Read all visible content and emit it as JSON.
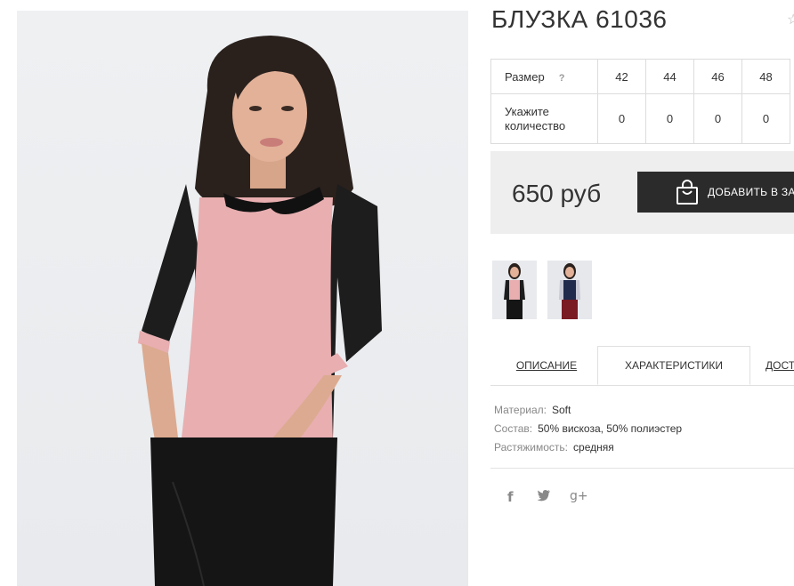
{
  "product": {
    "title": "БЛУЗКА 61036",
    "favorite_icon": "star-icon"
  },
  "size_table": {
    "size_label": "Размер",
    "help_mark": "?",
    "sizes": [
      "42",
      "44",
      "46",
      "48"
    ],
    "qty_label": "Укажите количество",
    "quantities": [
      "0",
      "0",
      "0",
      "0"
    ]
  },
  "purchase": {
    "price": "650 руб",
    "cart_button": "ДОБАВИТЬ В ЗАКАЗ",
    "cart_icon": "shopping-bag-icon"
  },
  "thumbnails": [
    "thumb-pink-blouse",
    "thumb-navy-blouse"
  ],
  "tabs": {
    "description": "ОПИСАНИЕ",
    "characteristics": "ХАРАКТЕРИСТИКИ",
    "delivery": "ДОСТАВКА"
  },
  "characteristics": [
    {
      "key": "Материал:",
      "value": "Soft"
    },
    {
      "key": "Состав:",
      "value": "50% вискоза, 50% полиэстер"
    },
    {
      "key": "Растяжимость:",
      "value": "средняя"
    }
  ],
  "social": {
    "facebook": "f",
    "twitter": "twitter-icon",
    "gplus": "g+"
  },
  "colors": {
    "button_bg": "#2b2b2b",
    "price_bg": "#eeeeee",
    "blouse_pink": "#e8aeb0",
    "blouse_black": "#1d1d1d"
  }
}
